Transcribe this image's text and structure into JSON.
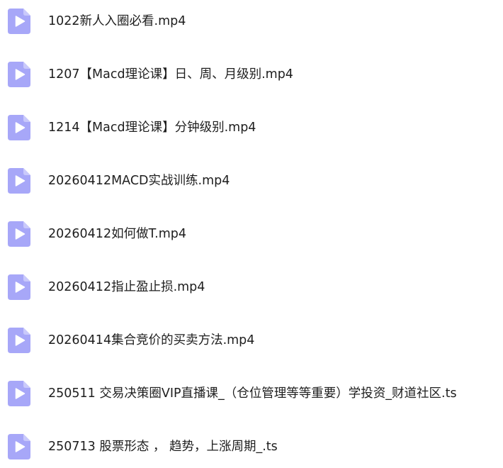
{
  "icon": "video-file-icon",
  "colors": {
    "icon_body": "#a7a7f8",
    "icon_fold": "#c9c9fb",
    "icon_play": "#ffffff",
    "text": "#1e1e1e",
    "background": "#ffffff"
  },
  "files": [
    {
      "name": "1022新人入圈必看.mp4"
    },
    {
      "name": "1207【Macd理论课】日、周、月级别.mp4"
    },
    {
      "name": "1214【Macd理论课】分钟级别.mp4"
    },
    {
      "name": "20260412MACD实战训练.mp4"
    },
    {
      "name": "20260412如何做T.mp4"
    },
    {
      "name": "20260412指止盈止损.mp4"
    },
    {
      "name": "20260414集合竞价的买卖方法.mp4"
    },
    {
      "name": "250511 交易决策圈VIP直播课_（仓位管理等等重要）学投资_财道社区.ts"
    },
    {
      "name": "250713 股票形态 ， 趋势，上涨周期_.ts"
    }
  ]
}
